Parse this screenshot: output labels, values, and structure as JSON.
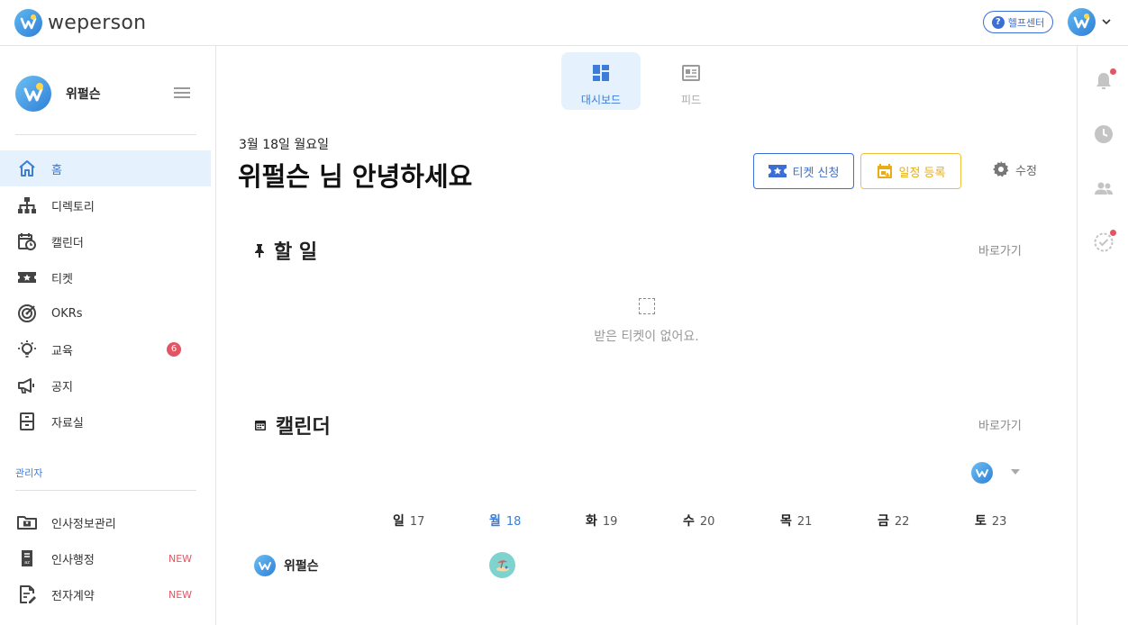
{
  "brand": {
    "name": "weperson"
  },
  "header": {
    "help_label": "헬프센터",
    "help_icon": "?"
  },
  "sidebar": {
    "org_name": "위펄슨",
    "nav": [
      {
        "label": "홈",
        "icon": "home-icon",
        "active": true
      },
      {
        "label": "디렉토리",
        "icon": "org-chart-icon"
      },
      {
        "label": "캘린더",
        "icon": "calendar-clock-icon"
      },
      {
        "label": "티켓",
        "icon": "ticket-icon"
      },
      {
        "label": "OKRs",
        "icon": "target-icon"
      },
      {
        "label": "교육",
        "icon": "lightbulb-icon",
        "badge": "6"
      },
      {
        "label": "공지",
        "icon": "megaphone-icon"
      },
      {
        "label": "자료실",
        "icon": "cabinet-icon"
      }
    ],
    "admin_section_label": "관리자",
    "admin_nav": [
      {
        "label": "인사정보관리",
        "icon": "id-folder-icon"
      },
      {
        "label": "인사행정",
        "icon": "document-az-icon",
        "tag": "NEW"
      },
      {
        "label": "전자계약",
        "icon": "contract-edit-icon",
        "tag": "NEW"
      }
    ]
  },
  "main": {
    "view_tabs": [
      {
        "label": "대시보드",
        "icon": "dashboard-icon",
        "active": true
      },
      {
        "label": "피드",
        "icon": "feed-icon"
      }
    ],
    "date": "3월 18일 월요일",
    "greeting": "위펄슨 님 안녕하세요",
    "ticket_button": "티켓 신청",
    "schedule_button": "일정 등록",
    "edit_label": "수정",
    "todo": {
      "title": "할 일",
      "go_label": "바로가기",
      "empty_text": "받은 티켓이 없어요."
    },
    "calendar": {
      "title": "캘린더",
      "go_label": "바로가기",
      "days": [
        {
          "name": "일",
          "date": "17"
        },
        {
          "name": "월",
          "date": "18",
          "today": true
        },
        {
          "name": "화",
          "date": "19"
        },
        {
          "name": "수",
          "date": "20"
        },
        {
          "name": "목",
          "date": "21"
        },
        {
          "name": "금",
          "date": "22"
        },
        {
          "name": "토",
          "date": "23"
        }
      ],
      "member_name": "위펄슨"
    }
  },
  "colors": {
    "accent": "#3b7dd8",
    "warning": "#e8ad16",
    "badge": "#e25563"
  }
}
